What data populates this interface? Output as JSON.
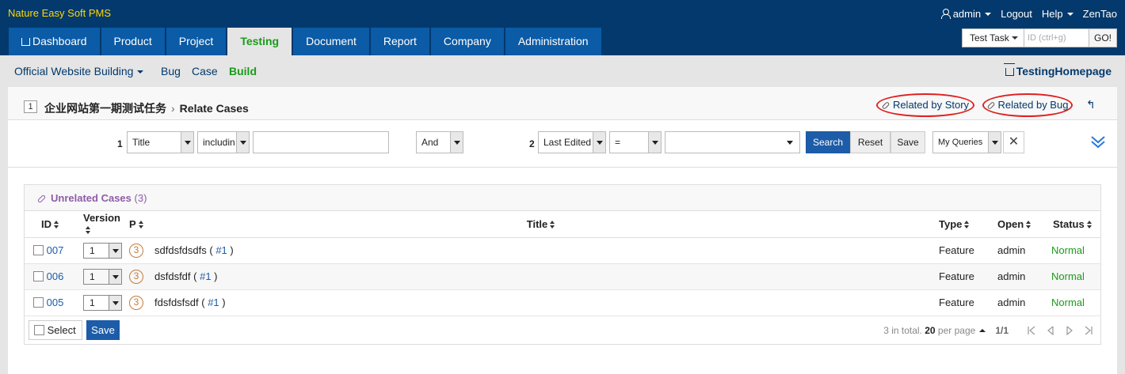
{
  "app": {
    "brand": "Nature Easy Soft PMS"
  },
  "user_bar": {
    "user": "admin",
    "logout": "Logout",
    "help": "Help",
    "zentao": "ZenTao"
  },
  "main_nav": [
    {
      "label": "Dashboard"
    },
    {
      "label": "Product"
    },
    {
      "label": "Project"
    },
    {
      "label": "Testing"
    },
    {
      "label": "Document"
    },
    {
      "label": "Report"
    },
    {
      "label": "Company"
    },
    {
      "label": "Administration"
    }
  ],
  "quick": {
    "type": "Test Task",
    "placeholder": "ID (ctrl+g)",
    "go": "GO!"
  },
  "sub_nav": {
    "project": "Official Website Building",
    "bug": "Bug",
    "case": "Case",
    "build": "Build",
    "home": "TestingHomepage"
  },
  "title_bar": {
    "id": "1",
    "task_name": "企业网站第一期测试任务",
    "separator": "›",
    "page": "Relate Cases",
    "related_story": "Related by Story",
    "related_bug": "Related by Bug",
    "back": "↰"
  },
  "search": {
    "group1_num": "1",
    "field1": "Title",
    "operator1": "includin",
    "logic": "And",
    "group2_num": "2",
    "field2": "Last Edited",
    "operator2": "=",
    "search_btn": "Search",
    "reset_btn": "Reset",
    "save_btn": "Save",
    "my_queries": "My Queries",
    "close": "✕"
  },
  "panel": {
    "title": "Unrelated Cases",
    "count": "(3)"
  },
  "table": {
    "headers": {
      "id": "ID",
      "version": "Version",
      "pri": "P",
      "title": "Title",
      "type": "Type",
      "open": "Open",
      "status": "Status"
    },
    "rows": [
      {
        "id": "007",
        "version": "1",
        "pri": "3",
        "title": "sdfdsfdsdfs",
        "title_open": " ( ",
        "ref": "#1",
        "title_close": " )",
        "type": "Feature",
        "open": "admin",
        "status": "Normal"
      },
      {
        "id": "006",
        "version": "1",
        "pri": "3",
        "title": "dsfdsfdf",
        "title_open": " ( ",
        "ref": "#1",
        "title_close": " )",
        "type": "Feature",
        "open": "admin",
        "status": "Normal"
      },
      {
        "id": "005",
        "version": "1",
        "pri": "3",
        "title": "fdsfdsfsdf",
        "title_open": " ( ",
        "ref": "#1",
        "title_close": " )",
        "type": "Feature",
        "open": "admin",
        "status": "Normal"
      }
    ]
  },
  "footer": {
    "select": "Select",
    "save": "Save",
    "total": "3 in total.",
    "per_page": "20",
    "per_page_label": " per page",
    "page": "1/1"
  },
  "colors": {
    "header": "#03396c",
    "nav": "#0b5ba6",
    "active": "#1a9b1a",
    "primary": "#1d5ca8",
    "highlight": "#e02020"
  }
}
